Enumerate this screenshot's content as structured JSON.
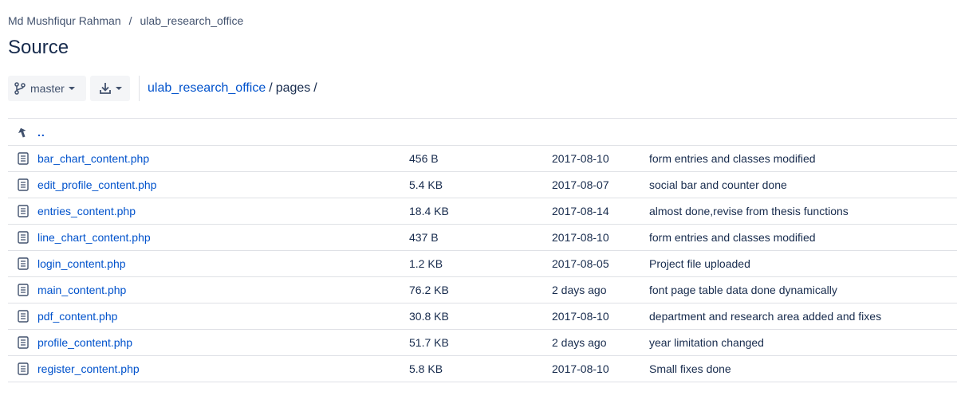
{
  "breadcrumb": {
    "owner": "Md Mushfiqur Rahman",
    "separator": "/",
    "repo": "ulab_research_office"
  },
  "page_title": "Source",
  "toolbar": {
    "branch_label": "master",
    "branch_icon": "branch-icon",
    "download_icon": "download-icon"
  },
  "path": {
    "repo_link": "ulab_research_office",
    "sep1": "/",
    "folder": "pages",
    "sep2": "/"
  },
  "parent_row": {
    "icon": "up-arrow-icon",
    "label": ".."
  },
  "files": [
    {
      "name": "bar_chart_content.php",
      "size": "456 B",
      "date": "2017-08-10",
      "message": "form entries and classes modified"
    },
    {
      "name": "edit_profile_content.php",
      "size": "5.4 KB",
      "date": "2017-08-07",
      "message": "social bar and counter done"
    },
    {
      "name": "entries_content.php",
      "size": "18.4 KB",
      "date": "2017-08-14",
      "message": "almost done,revise from thesis functions"
    },
    {
      "name": "line_chart_content.php",
      "size": "437 B",
      "date": "2017-08-10",
      "message": "form entries and classes modified"
    },
    {
      "name": "login_content.php",
      "size": "1.2 KB",
      "date": "2017-08-05",
      "message": "Project file uploaded"
    },
    {
      "name": "main_content.php",
      "size": "76.2 KB",
      "date": "2 days ago",
      "message": "font page table data done dynamically"
    },
    {
      "name": "pdf_content.php",
      "size": "30.8 KB",
      "date": "2017-08-10",
      "message": "department and research area added and fixes"
    },
    {
      "name": "profile_content.php",
      "size": "51.7 KB",
      "date": "2 days ago",
      "message": "year limitation changed"
    },
    {
      "name": "register_content.php",
      "size": "5.8 KB",
      "date": "2017-08-10",
      "message": "Small fixes done"
    }
  ],
  "colors": {
    "link": "#0052cc",
    "text": "#172b4d",
    "muted": "#42526e",
    "border": "#dfe1e6",
    "button_bg": "#f4f5f7"
  }
}
